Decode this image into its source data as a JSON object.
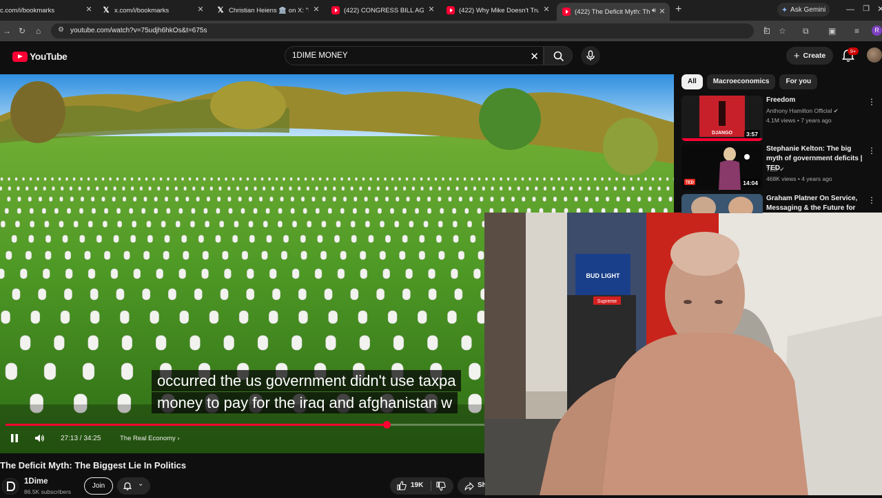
{
  "browser": {
    "tabs": [
      {
        "label": "c.com/i/bookmarks",
        "favicon": "x-icon",
        "active": false
      },
      {
        "label": "x.com/i/bookmarks",
        "favicon": "x-icon",
        "active": false
      },
      {
        "label": "Christian Heiens 🏛️ on X: \"It's t",
        "favicon": "x-icon",
        "active": false
      },
      {
        "label": "(422) CONGRESS BILL AGAINST",
        "favicon": "youtube-icon",
        "active": false
      },
      {
        "label": "(422) Why Mike Doesn't Trust Hi",
        "favicon": "youtube-icon",
        "active": false
      },
      {
        "label": "(422) The Deficit Myth: The",
        "favicon": "youtube-icon",
        "active": true
      }
    ],
    "new_tab": "+",
    "ask_gemini": "Ask Gemini",
    "url": "youtube.com/watch?v=75udjh6hkOs&t=675s",
    "profile_initial": "R"
  },
  "youtube": {
    "logo_text": "YouTube",
    "search_query": "1DIME MONEY",
    "create_label": "Create",
    "notification_badge": "9+"
  },
  "player": {
    "caption_lines": [
      "occurred the us government didn't use taxpa",
      "money to pay for the iraq and afghanistan w"
    ],
    "time": "27:13 / 34:25",
    "chapter": "The Real Economy",
    "progress_fraction": 0.79,
    "accent": "#ff0033"
  },
  "video": {
    "title": "The Deficit Myth: The Biggest Lie In Politics",
    "channel": "1Dime",
    "subscribers": "86.5K subscribers",
    "join_label": "Join",
    "likes": "19K",
    "share_label": "Sh"
  },
  "filters": [
    "All",
    "Macroeconomics",
    "For you"
  ],
  "recommendations": [
    {
      "title": "Freedom",
      "channel": "Anthony Hamilton Official",
      "verified": true,
      "meta": "4.1M views • 7 years ago",
      "duration": "3:57"
    },
    {
      "title": "Stephanie Kelton: The big myth of government deficits | TED",
      "channel": "TED",
      "verified": true,
      "meta": "468K views • 4 years ago",
      "duration": "14:04"
    },
    {
      "title": "Graham Platner On Service, Messaging & the Future for ...",
      "channel": "",
      "verified": false,
      "meta": "",
      "duration": ""
    }
  ],
  "thumbnail_labels": {
    "rec1_text": "DJANGO",
    "rec2_badge": "TED"
  },
  "webcam_labels": {
    "can_text": "BUD LIGHT",
    "sticker_text": "Supreme"
  }
}
